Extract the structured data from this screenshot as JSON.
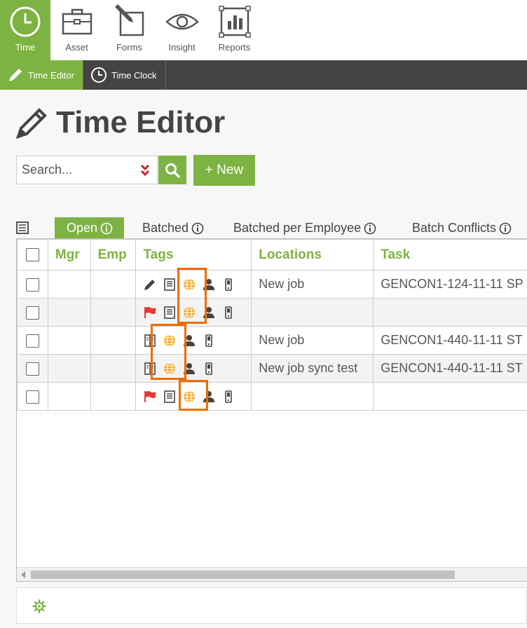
{
  "nav": {
    "items": [
      {
        "label": "Time",
        "icon": "clock-icon"
      },
      {
        "label": "Asset",
        "icon": "briefcase-icon"
      },
      {
        "label": "Forms",
        "icon": "form-edit-icon"
      },
      {
        "label": "Insight",
        "icon": "eye-icon"
      },
      {
        "label": "Reports",
        "icon": "chart-icon"
      }
    ]
  },
  "subnav": {
    "items": [
      {
        "label": "Time Editor",
        "icon": "pencil-icon"
      },
      {
        "label": "Time Clock",
        "icon": "clock-icon"
      }
    ]
  },
  "page": {
    "title": "Time Editor"
  },
  "search": {
    "placeholder": "Search...",
    "value": ""
  },
  "toolbar": {
    "new_label": "+ New"
  },
  "tabs": [
    {
      "label": "Open"
    },
    {
      "label": "Batched"
    },
    {
      "label": "Batched per Employee"
    },
    {
      "label": "Batch Conflicts"
    }
  ],
  "table": {
    "columns": [
      "Mgr",
      "Emp",
      "Tags",
      "Locations",
      "Task"
    ],
    "rows": [
      {
        "location": "New job",
        "task": "GENCON1-124-11-11 SP",
        "tags": [
          "pencil-icon",
          "note-icon",
          "globe-icon",
          "person-icon",
          "phone-icon"
        ]
      },
      {
        "location": "",
        "task": "",
        "tags": [
          "flag-icon",
          "note-icon",
          "globe-icon",
          "person-icon",
          "phone-icon"
        ]
      },
      {
        "location": "New job",
        "task": "GENCON1-440-11-11 ST",
        "tags": [
          "book-icon",
          "globe-icon",
          "person-icon",
          "phone-icon"
        ]
      },
      {
        "location": "New job sync test",
        "task": "GENCON1-440-11-11 ST",
        "tags": [
          "book-icon",
          "globe-icon",
          "person-icon",
          "phone-icon"
        ]
      },
      {
        "location": "",
        "task": "",
        "tags": [
          "flag-icon",
          "note-icon",
          "globe-icon",
          "person-icon",
          "phone-icon"
        ]
      }
    ]
  },
  "colors": {
    "accent": "#7cb342",
    "dark": "#444444",
    "highlight": "#ef6c00",
    "flag": "#e53935",
    "globe": "#f5a623"
  }
}
